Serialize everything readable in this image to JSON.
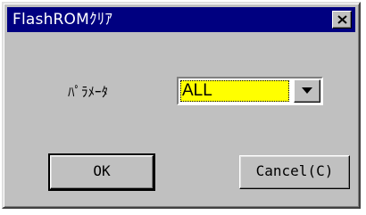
{
  "window": {
    "title": "FlashROMｸﾘｱ",
    "close_icon": "close-icon"
  },
  "form": {
    "param_label": "ﾊﾟﾗﾒｰﾀ",
    "param_select": {
      "selected": "ALL",
      "highlight_color": "#ffff00"
    }
  },
  "buttons": {
    "ok_label": "OK",
    "cancel_label": "Cancel(C)"
  },
  "colors": {
    "titlebar": "#000080",
    "face": "#c0c0c0"
  }
}
